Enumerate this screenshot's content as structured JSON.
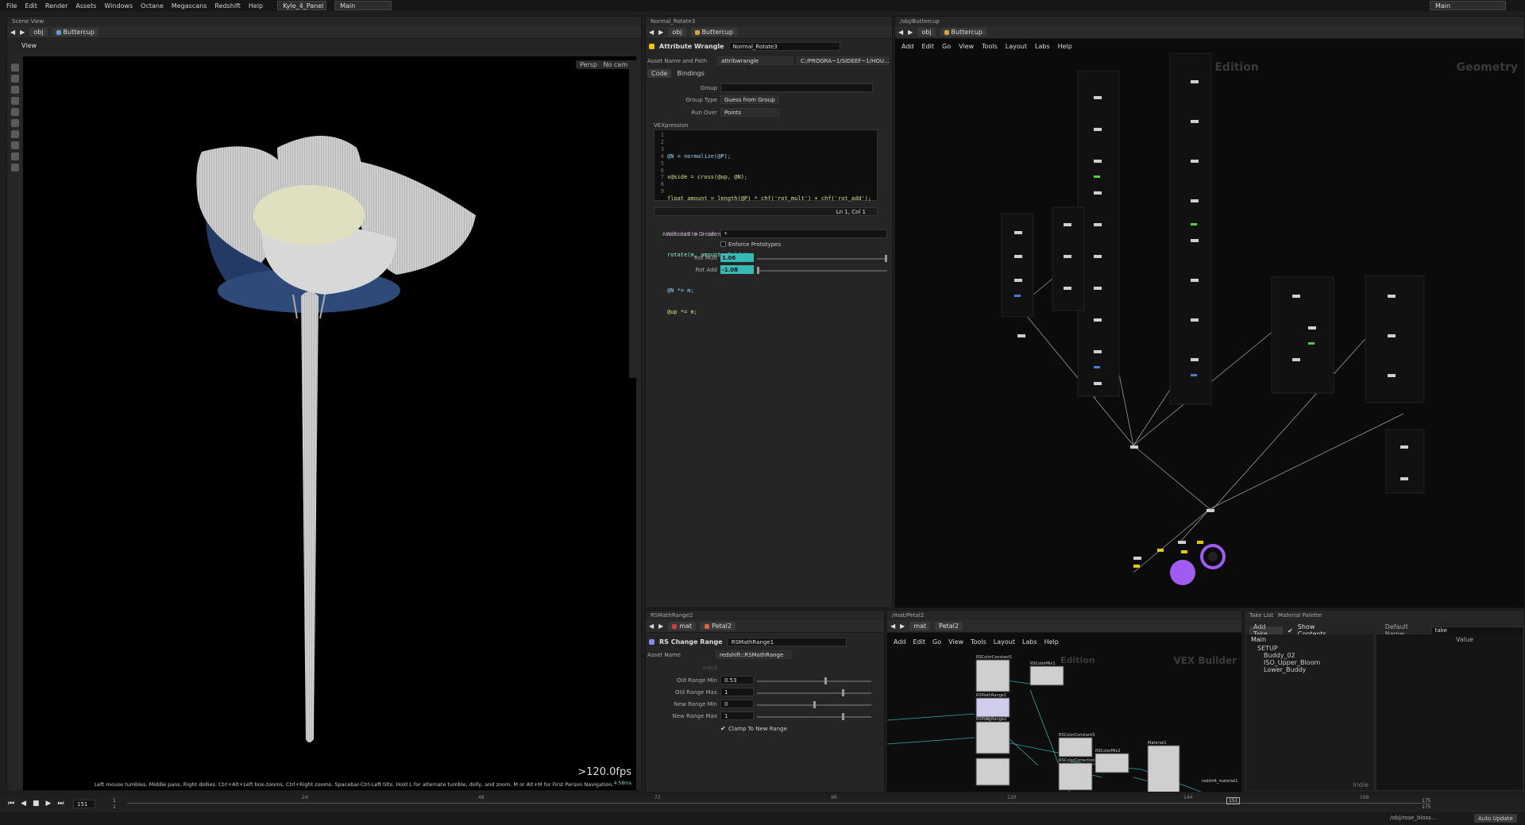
{
  "menubar": {
    "items": [
      "File",
      "Edit",
      "Render",
      "Assets",
      "Windows",
      "Octane",
      "Megascans",
      "Redshift",
      "Help"
    ],
    "desktop": "Kyle_4_Panel",
    "main_label": "Main",
    "right_main": "Main"
  },
  "scene_view": {
    "tab": "Scene View",
    "path_obj": "obj",
    "path_node": "Buttercup",
    "view_label": "View",
    "persp": "Persp",
    "cam": "No cam",
    "fps": ">120.0fps",
    "fps_sub": "4.58ms",
    "hint": "Left mouse tumbles. Middle pans. Right dollies. Ctrl+Alt+Left box-zooms. Ctrl+Right zooms. Spacebar-Ctrl-Left tilts. Hold L for alternate tumble, dolly, and zoom.     M or Alt+M for First Person Navigation."
  },
  "params": {
    "tab": "Normal_Rotate3",
    "path_obj": "obj",
    "path_node": "Buttercup",
    "node_type": "Attribute Wrangle",
    "node_name": "Normal_Rotate3",
    "asset_label": "Asset Name and Path",
    "asset_value": "attribwrangle",
    "asset_path": "C:/PROGRA~1/SIDEEF~1/HOU...",
    "tabs": [
      "Code",
      "Bindings"
    ],
    "group_label": "Group",
    "group_type_label": "Group Type",
    "group_type_value": "Guess from Group",
    "run_over_label": "Run Over",
    "run_over_value": "Points",
    "vex_label": "VEXpression",
    "code_lines": [
      "@N = normalize(@P);",
      "v@side = cross(@up, @N);",
      "float amount = length(@P) * chf('rot_mult') + chf('rot_add');",
      "",
      "matrix3 m = ident();",
      "rotate(m, amount, @side);",
      "",
      "@N *= m;",
      "@up *= m;"
    ],
    "line_nums": [
      "1",
      "2",
      "3",
      "4",
      "5",
      "6",
      "7",
      "8",
      "9"
    ],
    "cursor_pos": "Ln 1, Col 1",
    "attrs_label": "Attributes to Create",
    "attrs_value": "*",
    "enforce_label": "Enforce Prototypes",
    "rot_mult_label": "Rot Mult",
    "rot_mult_value": "1.06",
    "rot_mult_fraction": 1.0,
    "rot_add_label": "Rot Add",
    "rot_add_value": "-1.08",
    "rot_add_fraction": 0.0
  },
  "network": {
    "tab": "/obj/Buttercup",
    "path_obj": "obj",
    "path_node": "Buttercup",
    "menu": [
      "Add",
      "Edit",
      "Go",
      "View",
      "Tools",
      "Layout",
      "Labs",
      "Help"
    ],
    "watermark": "Geometry",
    "indie": "Indie Edition"
  },
  "rs_params": {
    "tab": "RSMathRange2",
    "path_obj": "mat",
    "path_node": "Petal2",
    "node_type": "RS Change Range",
    "node_name": "RSMathRange1",
    "asset_label": "Asset Name",
    "asset_value": "redshift::RSMathRange",
    "input_label": "Input",
    "rows": [
      {
        "label": "Old Range Min",
        "value": "0.53",
        "fraction": 0.6
      },
      {
        "label": "Old Range Max",
        "value": "1",
        "fraction": 0.75
      },
      {
        "label": "New Range Min",
        "value": "0",
        "fraction": 0.5
      },
      {
        "label": "New Range Max",
        "value": "1",
        "fraction": 0.75
      }
    ],
    "clamp_label": "Clamp To New Range"
  },
  "vex_builder": {
    "tab": "/mat/Petal2",
    "path_obj": "mat",
    "path_node": "Petal2",
    "menu": [
      "Add",
      "Edit",
      "Go",
      "View",
      "Tools",
      "Layout",
      "Labs",
      "Help"
    ],
    "watermark": "VEX Builder",
    "indie": "Edition",
    "nodes": [
      "RSColorConstant1",
      "RSColorMix1",
      "RSMathRange1",
      "RSMathRange2",
      "RSColorConstant3",
      "RSColorCorrection1",
      "RSColorMix2",
      "Material1",
      "redshift_material1"
    ]
  },
  "takes": {
    "tab1": "Take List",
    "tab2": "Material Palette",
    "add_take": "Add Take",
    "show_contents": "Show Contents",
    "default_name_label": "Default Name:",
    "default_name_value": "take",
    "value_header": "Value",
    "tree": [
      "Main",
      "SETUP",
      "Buddy_02",
      "ISO_Upper_Bloom",
      "Lower_Buddy"
    ],
    "indie": "Indie"
  },
  "timeline": {
    "frame": "151",
    "start": "1",
    "start2": "1",
    "ticks": [
      "24",
      "48",
      "72",
      "96",
      "120",
      "144",
      "168"
    ],
    "current_marker": "151",
    "end": "175",
    "end2": "175"
  },
  "status": {
    "path": "/obj/rose_bloss...",
    "auto_update": "Auto Update"
  },
  "colors": {
    "teal": "#38b9b5",
    "purple": "#a05cf0",
    "accent_yellow": "#e6c800"
  }
}
